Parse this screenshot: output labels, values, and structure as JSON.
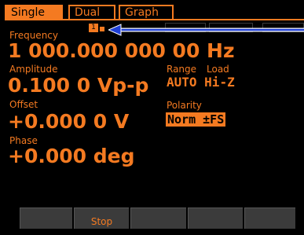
{
  "tabs": [
    {
      "label": "Single",
      "active": true
    },
    {
      "label": "Dual",
      "active": false
    },
    {
      "label": "Graph",
      "active": false
    }
  ],
  "channel_marker": "1",
  "frequency": {
    "label": "Frequency",
    "value": "1 000.000 000 00 Hz"
  },
  "amplitude": {
    "label": "Amplitude",
    "value": "0.100 0 Vp-p"
  },
  "range": {
    "label": "Range",
    "value": "AUTO"
  },
  "load": {
    "label": "Load",
    "value": "Hi-Z"
  },
  "offset": {
    "label": "Offset",
    "value": "+0.000 0 V"
  },
  "polarity": {
    "label": "Polarity",
    "value": "Norm ±FS"
  },
  "phase": {
    "label": "Phase",
    "value": "+0.000 deg"
  },
  "softkeys": [
    "",
    "Stop",
    "",
    "",
    ""
  ],
  "colors": {
    "accent": "#f47a21",
    "background": "#000000",
    "softkey": "#3b3b3b",
    "arrow": "#1f3fd6"
  }
}
